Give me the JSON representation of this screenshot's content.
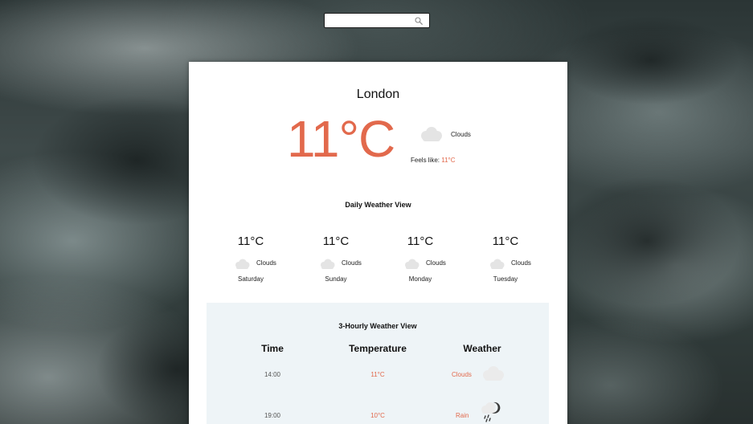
{
  "search": {
    "value": "",
    "placeholder": ""
  },
  "current": {
    "city": "London",
    "temperature": "11°C",
    "description": "Clouds",
    "feels_like_label": "Feels like:",
    "feels_like_value": "11°C",
    "icon": "cloud-icon"
  },
  "daily": {
    "title": "Daily Weather View",
    "days": [
      {
        "temp": "11°C",
        "description": "Clouds",
        "day": "Saturday",
        "icon": "cloud-icon"
      },
      {
        "temp": "11°C",
        "description": "Clouds",
        "day": "Sunday",
        "icon": "cloud-icon"
      },
      {
        "temp": "11°C",
        "description": "Clouds",
        "day": "Monday",
        "icon": "cloud-icon"
      },
      {
        "temp": "11°C",
        "description": "Clouds",
        "day": "Tuesday",
        "icon": "cloud-icon"
      }
    ]
  },
  "hourly": {
    "title": "3-Hourly Weather View",
    "headers": {
      "time": "Time",
      "temperature": "Temperature",
      "weather": "Weather"
    },
    "rows": [
      {
        "time": "14:00",
        "temp": "11°C",
        "description": "Clouds",
        "icon": "cloud-icon"
      },
      {
        "time": "19:00",
        "temp": "10°C",
        "description": "Rain",
        "icon": "rain-cloud-icon"
      }
    ]
  },
  "colors": {
    "accent": "#e2694c",
    "card_background": "#ffffff",
    "hourly_background": "#eef4f7",
    "cloud_icon": "#e4e4e4"
  }
}
